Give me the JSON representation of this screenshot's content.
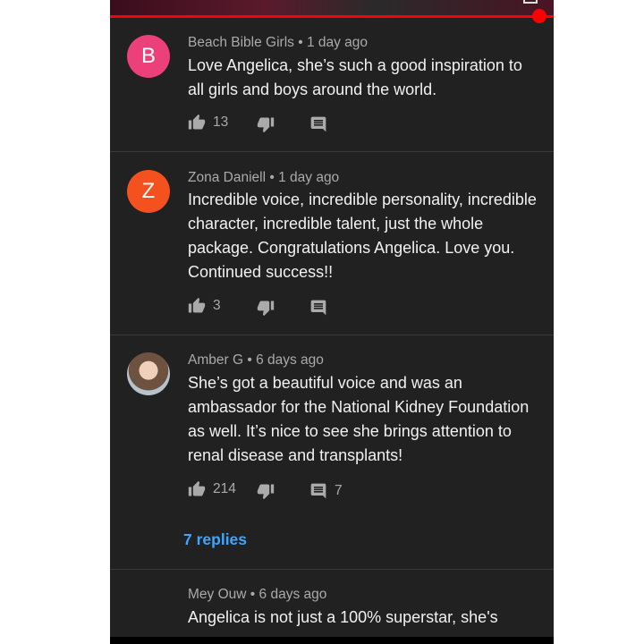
{
  "comments": [
    {
      "author": "Beach Bible Girls",
      "age": "1 day ago",
      "avatar_letter": "B",
      "avatar_color": "#ec407a",
      "text": "Love Angelica, she’s such a good inspiration to all girls and boys around the world.",
      "likes": "13",
      "replies_count": ""
    },
    {
      "author": "Zona Daniell",
      "age": "1 day ago",
      "avatar_letter": "Z",
      "avatar_color": "#f4511e",
      "text": "Incredible voice, incredible personality, incredible character, incredible talent, just the whole package. Congratulations Angelica. Love you. Continued success!!",
      "likes": "3",
      "replies_count": ""
    },
    {
      "author": "Amber G",
      "age": "6 days ago",
      "avatar_letter": "",
      "avatar_color": "#8d7b6a",
      "text": "She’s got a beautiful voice and was an ambassador for the National Kidney Foundation as well.  It’s nice to see she brings attention to renal disease and transplants!",
      "likes": "214",
      "replies_count": "7",
      "replies_link": "7 replies"
    },
    {
      "author": "Mey Ouw",
      "age": "6 days ago",
      "avatar_letter": "",
      "avatar_color": "",
      "text": "Angelica is not just a 100% superstar, she's"
    }
  ],
  "separator": "•",
  "icons": {
    "like": "thumb-up-icon",
    "dislike": "thumb-down-icon",
    "reply": "comment-icon",
    "more": "more-vert-icon",
    "fullscreen": "fullscreen-icon"
  },
  "colors": {
    "background": "#212121",
    "text": "#f1f1f1",
    "meta": "#aaaaaa",
    "link": "#3ea6ff",
    "progress": "#ff0000"
  }
}
